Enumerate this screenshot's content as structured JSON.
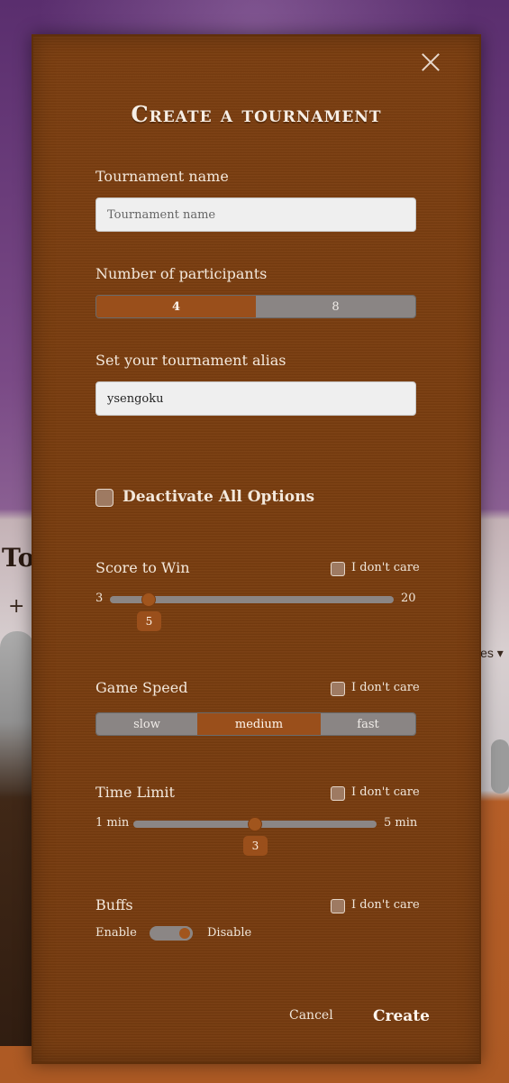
{
  "background": {
    "page_title_partial": "To",
    "plus_partial": "+ I",
    "filter_partial": "ies ▾"
  },
  "modal": {
    "title": "Create a tournament",
    "close_icon": "close-icon",
    "tournament_name": {
      "label": "Tournament name",
      "value": "",
      "placeholder": "Tournament name"
    },
    "participants": {
      "label": "Number of participants",
      "options": [
        "4",
        "8"
      ],
      "selected": "4"
    },
    "alias": {
      "label": "Set your tournament alias",
      "value": "ysengoku",
      "placeholder": ""
    },
    "deactivate_all": {
      "label": "Deactivate All Options",
      "checked": false
    },
    "dont_care_label": "I don't care",
    "score_to_win": {
      "label": "Score to Win",
      "min": "3",
      "max": "20",
      "value": "5"
    },
    "game_speed": {
      "label": "Game Speed",
      "options": [
        "slow",
        "medium",
        "fast"
      ],
      "selected": "medium"
    },
    "time_limit": {
      "label": "Time Limit",
      "min": "1 min",
      "max": "5 min",
      "value": "3"
    },
    "buffs": {
      "label": "Buffs",
      "enable_label": "Enable",
      "disable_label": "Disable",
      "state": "Disable"
    },
    "cancel_label": "Cancel",
    "create_label": "Create"
  },
  "colors": {
    "modal_bg": "#7a3e10",
    "accent": "#9a4f1b",
    "inactive": "#8a8584",
    "text": "#f3e8dc"
  }
}
